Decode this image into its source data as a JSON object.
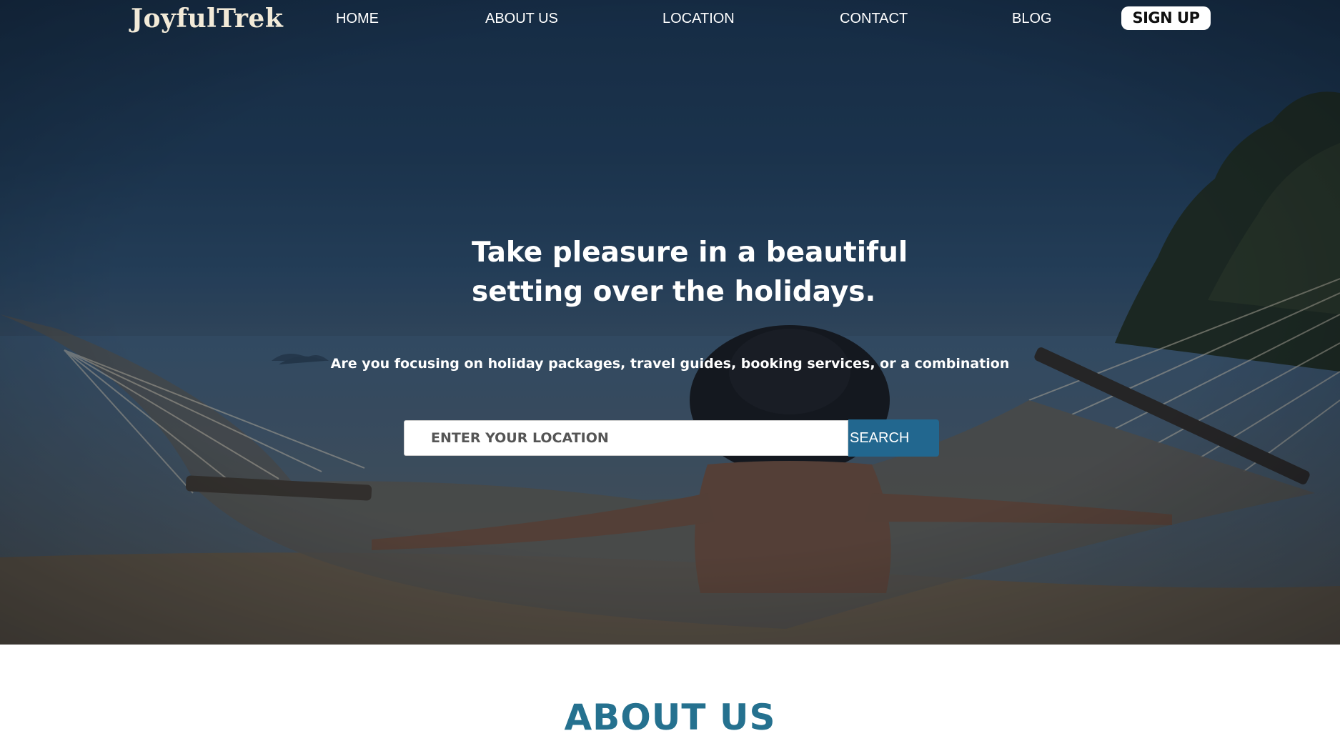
{
  "brand": {
    "logo": "JoyfulTrek"
  },
  "nav": {
    "items": [
      {
        "label": "HOME"
      },
      {
        "label": "ABOUT US"
      },
      {
        "label": "LOCATION"
      },
      {
        "label": "CONTACT"
      },
      {
        "label": "BLOG"
      }
    ],
    "signup_label": "SIGN UP"
  },
  "hero": {
    "headline_line1": "Take pleasure in a beautiful",
    "headline_line2": "setting over the holidays.",
    "subheadline": "Are you focusing on holiday packages, travel guides, booking services, or a combination",
    "search_placeholder": "ENTER YOUR LOCATION",
    "search_value": "",
    "search_button": "SEARCH"
  },
  "about": {
    "title": "ABOUT US"
  },
  "colors": {
    "accent": "#22678f",
    "about_title": "#25718f",
    "hero_overlay": "#1f3a55"
  }
}
